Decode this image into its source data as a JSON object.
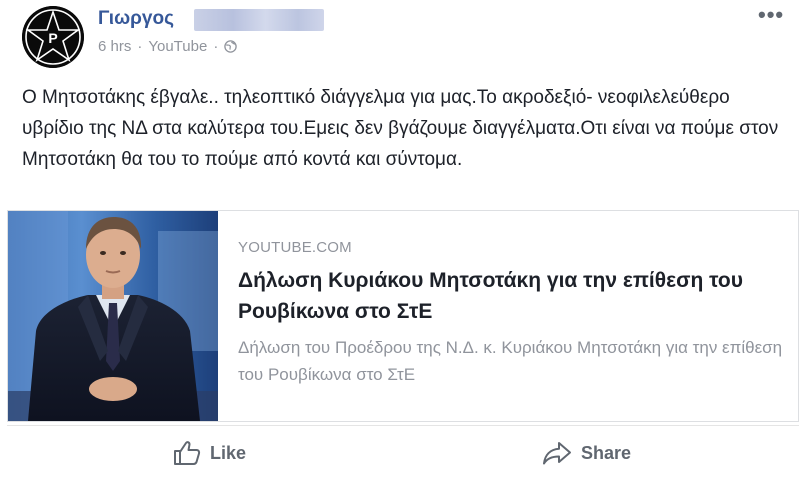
{
  "post": {
    "author": "Γιωργος",
    "time": "6 hrs",
    "source": "YouTube",
    "separator": "·",
    "more": "•••",
    "text": "Ο Μητσοτάκης έβγαλε.. τηλεοπτικό διάγγελμα για μας.Το ακροδεξιό- νεοφιλελεύθερο υβρίδιο της ΝΔ στα καλύτερα του.Εμεις δεν βγάζουμε διαγγέλματα.Οτι είναι να πούμε στον Μητσοτάκη θα του το πούμε από κοντά και σύντομα."
  },
  "link_card": {
    "domain": "YOUTUBE.COM",
    "title": "Δήλωση Κυριάκου Μητσοτάκη για την επίθεση του Ρουβίκωνα στο ΣτΕ",
    "description": "Δήλωση του Προέδρου της Ν.Δ. κ. Κυριάκου Μητσοτάκη για την επίθεση του Ρουβίκωνα στο ΣτΕ"
  },
  "actions": {
    "like_label": "Like",
    "share_label": "Share"
  },
  "colors": {
    "author_blue": "#365899",
    "meta_gray": "#90949c",
    "text": "#1d2129",
    "action_gray": "#606770"
  },
  "icons": {
    "avatar": "black-star-avatar",
    "privacy": "globe-icon",
    "like": "thumbs-up-icon",
    "share": "share-arrow-icon"
  }
}
